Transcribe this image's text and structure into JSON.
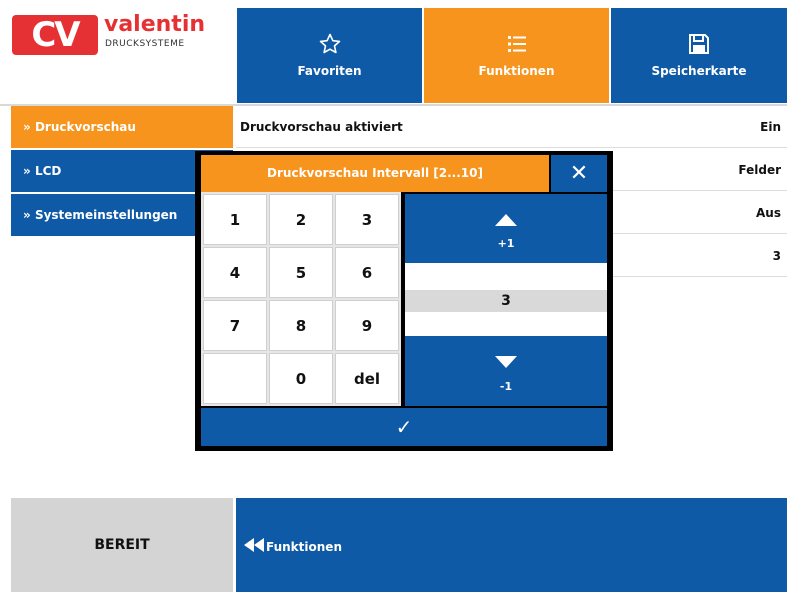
{
  "logo": {
    "mark": "CV",
    "name": "valentin",
    "subtitle": "DRUCKSYSTEME"
  },
  "tabs": [
    {
      "label": "Favoriten",
      "icon": "star-icon"
    },
    {
      "label": "Funktionen",
      "icon": "list-icon"
    },
    {
      "label": "Speicherkarte",
      "icon": "floppy-icon"
    }
  ],
  "sidebar": {
    "items": [
      {
        "label": "Druckvorschau"
      },
      {
        "label": "LCD"
      },
      {
        "label": "Systemeinstellungen"
      }
    ]
  },
  "settings": {
    "rows": [
      {
        "key": "Druckvorschau aktiviert",
        "value": "Ein"
      },
      {
        "key": "",
        "value": "Felder"
      },
      {
        "key": "",
        "value": "Aus"
      },
      {
        "key": "",
        "value": "3"
      }
    ]
  },
  "dialog": {
    "title": "Druckvorschau Intervall [2...10]",
    "keys": [
      "1",
      "2",
      "3",
      "4",
      "5",
      "6",
      "7",
      "8",
      "9",
      "",
      "0",
      "del"
    ],
    "up_label": "+1",
    "down_label": "-1",
    "value": "3"
  },
  "footer": {
    "status": "BEREIT",
    "back_label": "Funktionen"
  },
  "colors": {
    "blue": "#0f5aa7",
    "orange": "#f7941d",
    "red": "#e53134"
  }
}
